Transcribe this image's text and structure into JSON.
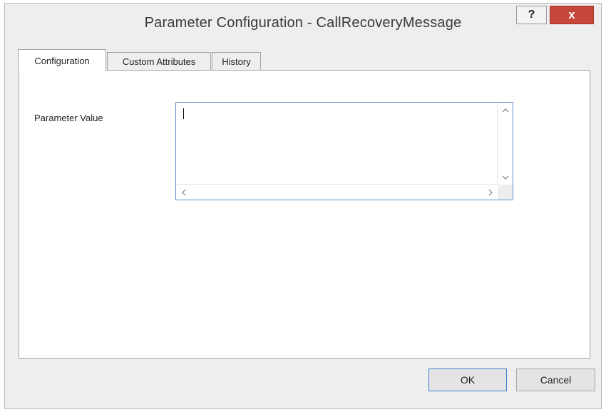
{
  "window": {
    "title": "Parameter Configuration - CallRecoveryMessage",
    "help_label": "?",
    "close_label": "x"
  },
  "tabs": [
    {
      "label": "Configuration",
      "active": true
    },
    {
      "label": "Custom Attributes",
      "active": false
    },
    {
      "label": "History",
      "active": false
    }
  ],
  "form": {
    "parameter_label": "Parameter Value",
    "parameter_value": ""
  },
  "scrollbar_icons": {
    "up": "chevron-up-icon",
    "down": "chevron-down-icon",
    "left": "chevron-left-icon",
    "right": "chevron-right-icon"
  },
  "buttons": {
    "ok": "OK",
    "cancel": "Cancel"
  },
  "colors": {
    "close_button": "#c7463a",
    "focus_border": "#5a90c6",
    "ok_border": "#3c7fd3"
  }
}
